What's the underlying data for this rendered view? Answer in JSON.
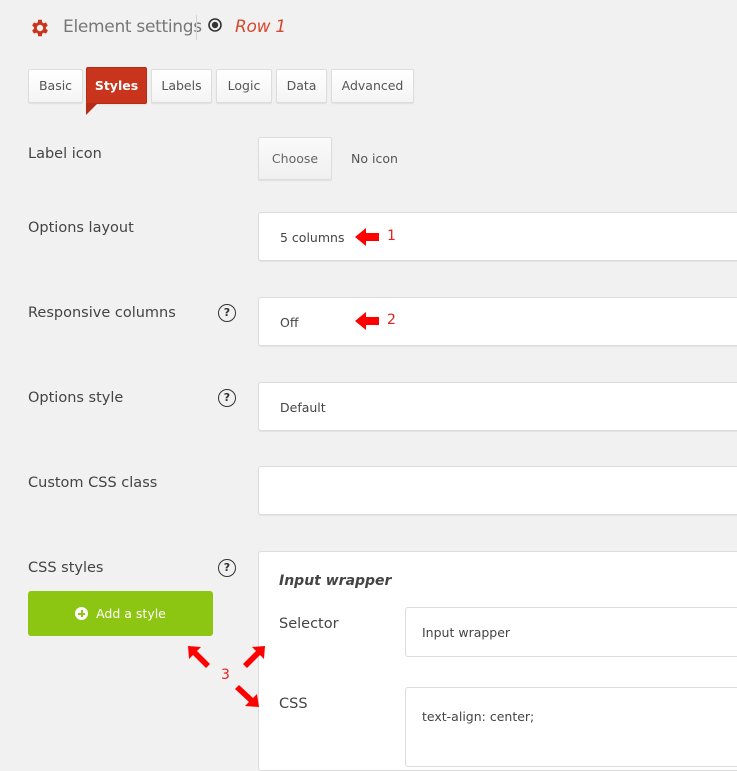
{
  "header": {
    "title": "Element settings",
    "element_name": "Row 1",
    "accent_color": "#c8341c"
  },
  "tabs": [
    {
      "label": "Basic",
      "active": false
    },
    {
      "label": "Styles",
      "active": true
    },
    {
      "label": "Labels",
      "active": false
    },
    {
      "label": "Logic",
      "active": false
    },
    {
      "label": "Data",
      "active": false
    },
    {
      "label": "Advanced",
      "active": false
    }
  ],
  "fields": {
    "label_icon": {
      "label": "Label icon",
      "button": "Choose",
      "value": "No icon"
    },
    "options_layout": {
      "label": "Options layout",
      "value": "5 columns"
    },
    "responsive_columns": {
      "label": "Responsive columns",
      "value": "Off",
      "help": "?"
    },
    "options_style": {
      "label": "Options style",
      "value": "Default",
      "help": "?"
    },
    "custom_css_class": {
      "label": "Custom CSS class",
      "value": ""
    },
    "css_styles": {
      "label": "CSS styles",
      "help": "?",
      "add_button": "Add a style",
      "add_button_color": "#8dc612",
      "style_entry": {
        "title": "Input wrapper",
        "selector_label": "Selector",
        "selector_value": "Input wrapper",
        "css_label": "CSS",
        "css_value": "text-align: center;"
      }
    }
  },
  "annotations": {
    "marker_1": "1",
    "marker_2": "2",
    "marker_3": "3",
    "color": "#e8201c"
  }
}
